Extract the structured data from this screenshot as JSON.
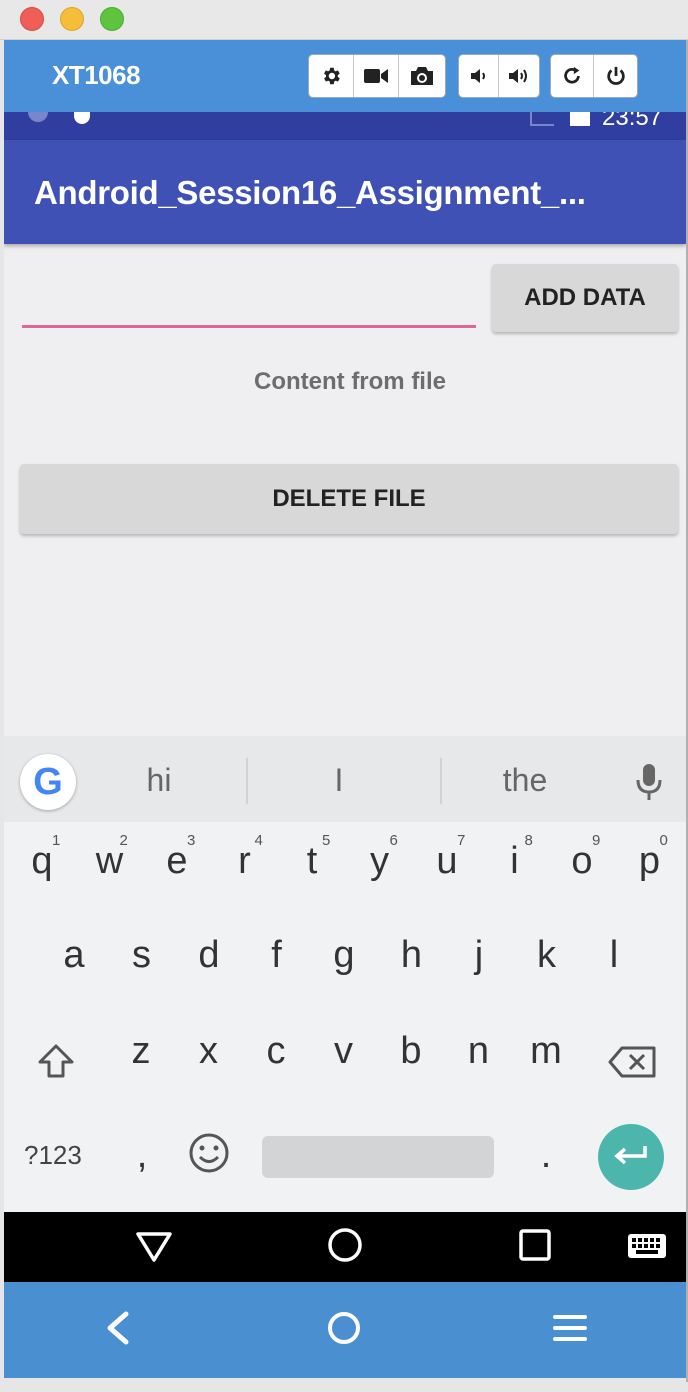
{
  "window": {
    "device_name": "XT1068"
  },
  "status_bar": {
    "time": "23:57"
  },
  "app": {
    "title": "Android_Session16_Assignment_...",
    "input_value": "",
    "add_button": "ADD DATA",
    "content_label": "Content from file",
    "delete_button": "DELETE FILE"
  },
  "keyboard": {
    "suggestions": [
      "hi",
      "I",
      "the"
    ],
    "row1": [
      "q",
      "w",
      "e",
      "r",
      "t",
      "y",
      "u",
      "i",
      "o",
      "p"
    ],
    "row1_hints": [
      "1",
      "2",
      "3",
      "4",
      "5",
      "6",
      "7",
      "8",
      "9",
      "0"
    ],
    "row2": [
      "a",
      "s",
      "d",
      "f",
      "g",
      "h",
      "j",
      "k",
      "l"
    ],
    "row3": [
      "z",
      "x",
      "c",
      "v",
      "b",
      "n",
      "m"
    ],
    "symbols_key": "?123",
    "comma_key": ",",
    "period_key": ".",
    "google_logo": "G"
  },
  "colors": {
    "emulator_bar": "#4a90d9",
    "app_bar": "#3f51b5",
    "status_bar": "#303f9f",
    "accent": "#e0669a",
    "enter_key": "#4db6ac"
  }
}
